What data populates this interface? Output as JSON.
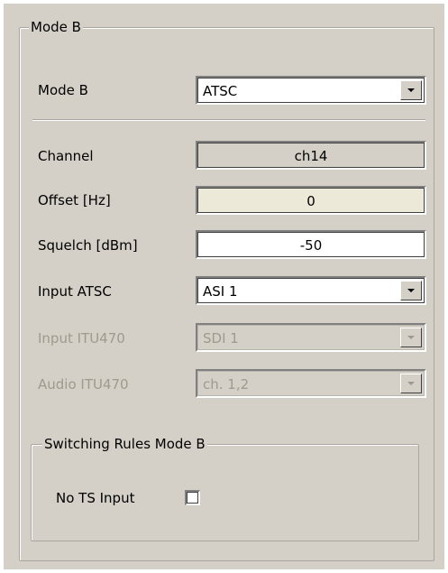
{
  "group": {
    "title": "Mode B"
  },
  "rows": {
    "mode_b": {
      "label": "Mode B",
      "value": "ATSC"
    },
    "channel": {
      "label": "Channel",
      "value": "ch14"
    },
    "offset": {
      "label": "Offset [Hz]",
      "value": "0"
    },
    "squelch": {
      "label": "Squelch [dBm]",
      "value": "-50"
    },
    "input_atsc": {
      "label": "Input ATSC",
      "value": "ASI 1"
    },
    "input_itu470": {
      "label": "Input ITU470",
      "value": "SDI 1"
    },
    "audio_itu470": {
      "label": "Audio ITU470",
      "value": "ch. 1,2"
    }
  },
  "switching": {
    "title": "Switching Rules Mode B",
    "no_ts_input_label": "No TS Input",
    "no_ts_input_checked": false
  },
  "colors": {
    "panel_bg": "#d4d0c8",
    "disabled_text": "#9e9a8e",
    "offset_bg": "#ece9d8"
  }
}
